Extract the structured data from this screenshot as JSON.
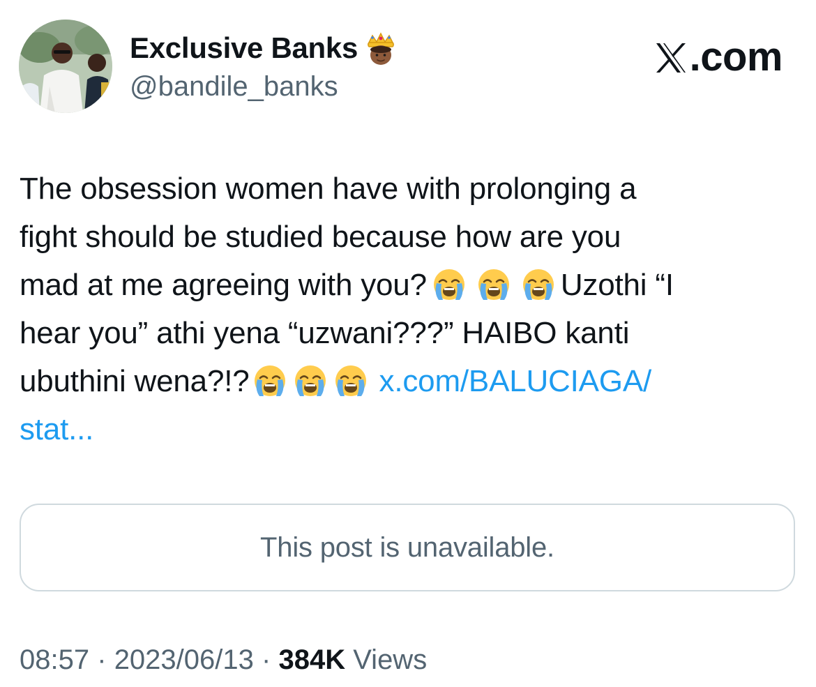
{
  "author": {
    "display_name": "Exclusive Banks",
    "handle": "@bandile_banks",
    "badge_icon": "crown-emoji-icon",
    "avatar_icon": "profile-photo"
  },
  "site": {
    "logo_text": ".com",
    "logo_icon": "x-logo-icon"
  },
  "tweet": {
    "line1": "The obsession women have with prolonging a",
    "line2": "fight should be studied because how are you",
    "line3_a": "mad at me agreeing with you?",
    "line3_b": "Uzothi “I",
    "line4": "hear you” athi yena “uzwani???” HAIBO kanti",
    "line5_a": "ubuthini wena?!?",
    "link_part1": "x.com/BALUCIAGA/",
    "link_part2": "stat...",
    "emoji_icon": "loudly-crying-face-emoji"
  },
  "quote_card": {
    "message": "This post is unavailable."
  },
  "meta": {
    "time": "08:57",
    "separator": "·",
    "date": "2023/06/13",
    "views_count": "384K",
    "views_label": "Views"
  },
  "colors": {
    "text": "#0f1419",
    "secondary": "#536471",
    "link": "#1d9bf0",
    "border": "#cfd9de"
  }
}
